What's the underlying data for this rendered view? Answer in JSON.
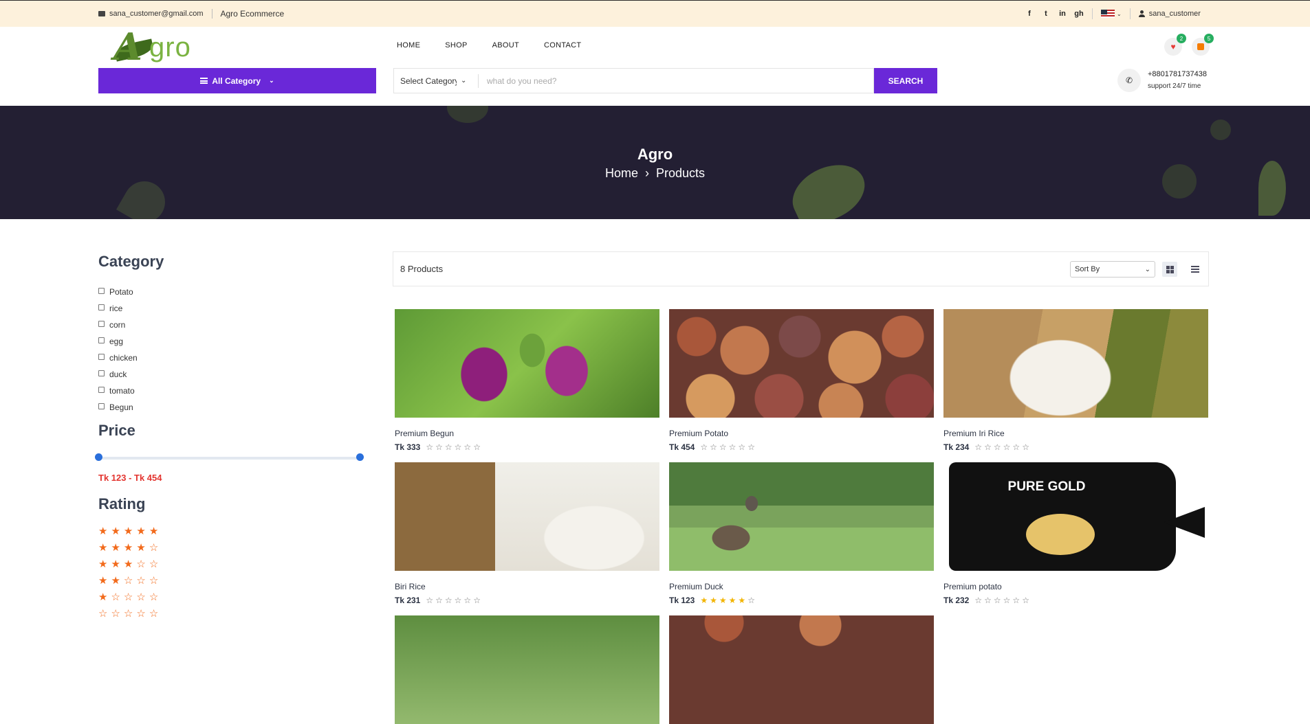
{
  "topbar": {
    "email": "sana_customer@gmail.com",
    "site_name": "Agro Ecommerce",
    "social": [
      "f",
      "t",
      "in",
      "gh"
    ],
    "language_flag": "us-flag-icon",
    "username": "sana_customer"
  },
  "header": {
    "logo_text": "gro",
    "logo_letter": "A",
    "nav": [
      "HOME",
      "SHOP",
      "ABOUT",
      "CONTACT"
    ],
    "wishlist_count": "2",
    "cart_count": "5",
    "all_category_label": "All Category",
    "select_category": "Select Category",
    "search_placeholder": "what do you need?",
    "search_button": "SEARCH",
    "phone": "+8801781737438",
    "support": "support 24/7 time",
    "accent_color": "#6a28d8"
  },
  "hero": {
    "title": "Agro",
    "breadcrumb_home": "Home",
    "breadcrumb_current": "Products"
  },
  "sidebar": {
    "category_heading": "Category",
    "categories": [
      "Potato",
      "rice",
      "corn",
      "egg",
      "chicken",
      "duck",
      "tomato",
      "Begun"
    ],
    "price_heading": "Price",
    "price_range": "Tk 123 - Tk 454",
    "rating_heading": "Rating",
    "ratings": [
      5,
      4,
      3,
      2,
      1,
      0
    ]
  },
  "toolbar": {
    "product_count": "8 Products",
    "sort_label": "Sort By"
  },
  "products": [
    {
      "name": "Premium Begun",
      "price": "Tk 333",
      "rating": 0
    },
    {
      "name": "Premium Potato",
      "price": "Tk 454",
      "rating": 0
    },
    {
      "name": "Premium Iri Rice",
      "price": "Tk 234",
      "rating": 0
    },
    {
      "name": "Biri Rice",
      "price": "Tk 231",
      "rating": 0
    },
    {
      "name": "Premium Duck",
      "price": "Tk 123",
      "rating": 5
    },
    {
      "name": "Premium potato",
      "price": "Tk 232",
      "rating": 0
    }
  ],
  "bag_text": "PURE GOLD"
}
